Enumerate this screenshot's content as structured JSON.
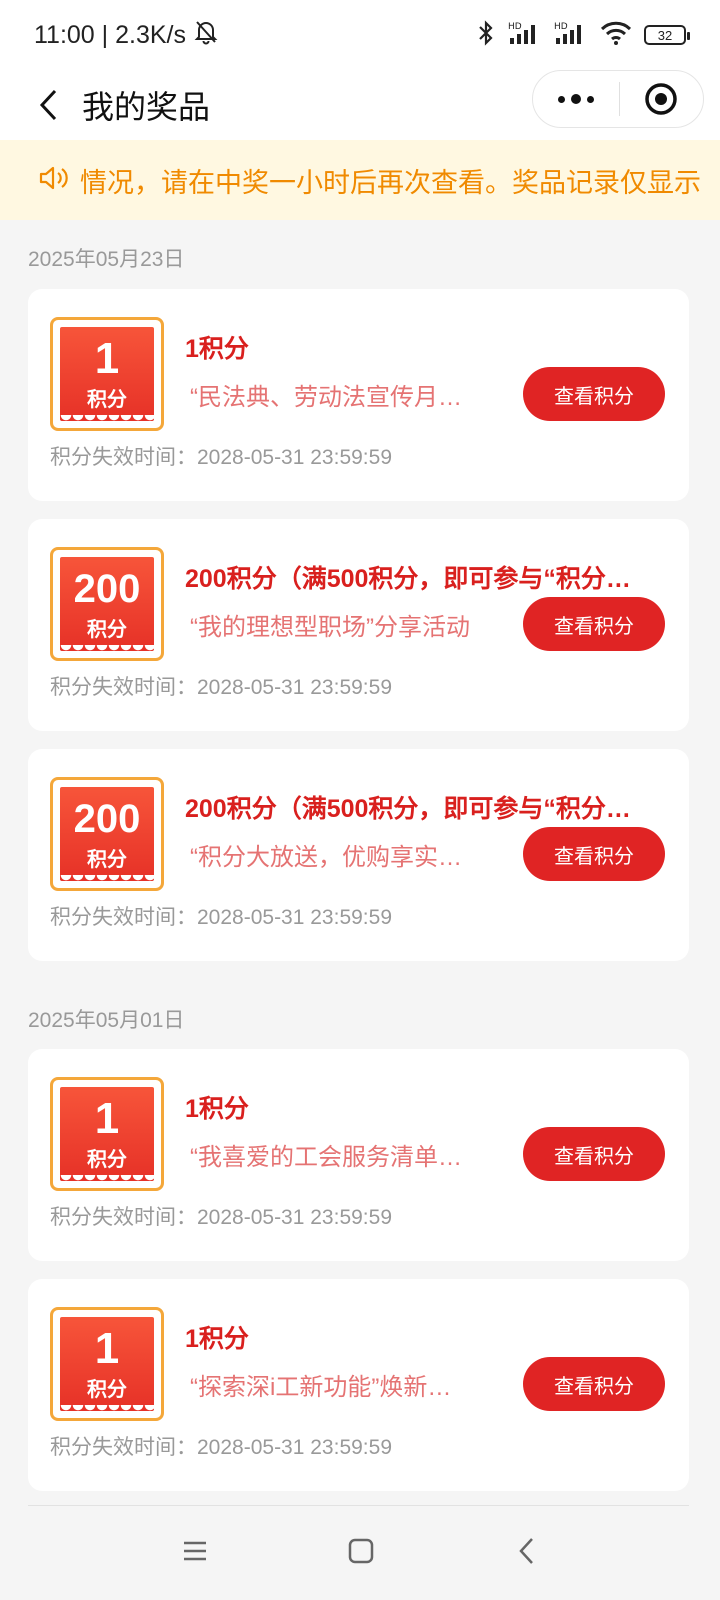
{
  "status_bar": {
    "time_speed": "11:00 | 2.3K/s",
    "battery": "32",
    "hd_label": "HD"
  },
  "header": {
    "title": "我的奖品"
  },
  "notice": {
    "text": "情况，请在中奖一小时后再次查看。奖品记录仅显示"
  },
  "sections": [
    {
      "date": "2025年05月23日",
      "cards": [
        {
          "badge_num": "1",
          "badge_unit": "积分",
          "title": "1积分",
          "subtitle": "“民法典、劳动法宣传月…",
          "button": "查看积分",
          "expire": "积分失效时间：2028-05-31 23:59:59"
        },
        {
          "badge_num": "200",
          "badge_unit": "积分",
          "title": "200积分（满500积分，即可参与“积分…",
          "subtitle": "“我的理想型职场”分享活动",
          "button": "查看积分",
          "expire": "积分失效时间：2028-05-31 23:59:59"
        },
        {
          "badge_num": "200",
          "badge_unit": "积分",
          "title": "200积分（满500积分，即可参与“积分…",
          "subtitle": "“积分大放送，优购享实…",
          "button": "查看积分",
          "expire": "积分失效时间：2028-05-31 23:59:59"
        }
      ]
    },
    {
      "date": "2025年05月01日",
      "cards": [
        {
          "badge_num": "1",
          "badge_unit": "积分",
          "title": "1积分",
          "subtitle": "“我喜爱的工会服务清单…",
          "button": "查看积分",
          "expire": "积分失效时间：2028-05-31 23:59:59"
        },
        {
          "badge_num": "1",
          "badge_unit": "积分",
          "title": "1积分",
          "subtitle": "“探索深i工新功能”焕新…",
          "button": "查看积分",
          "expire": "积分失效时间：2028-05-31 23:59:59"
        }
      ]
    }
  ]
}
